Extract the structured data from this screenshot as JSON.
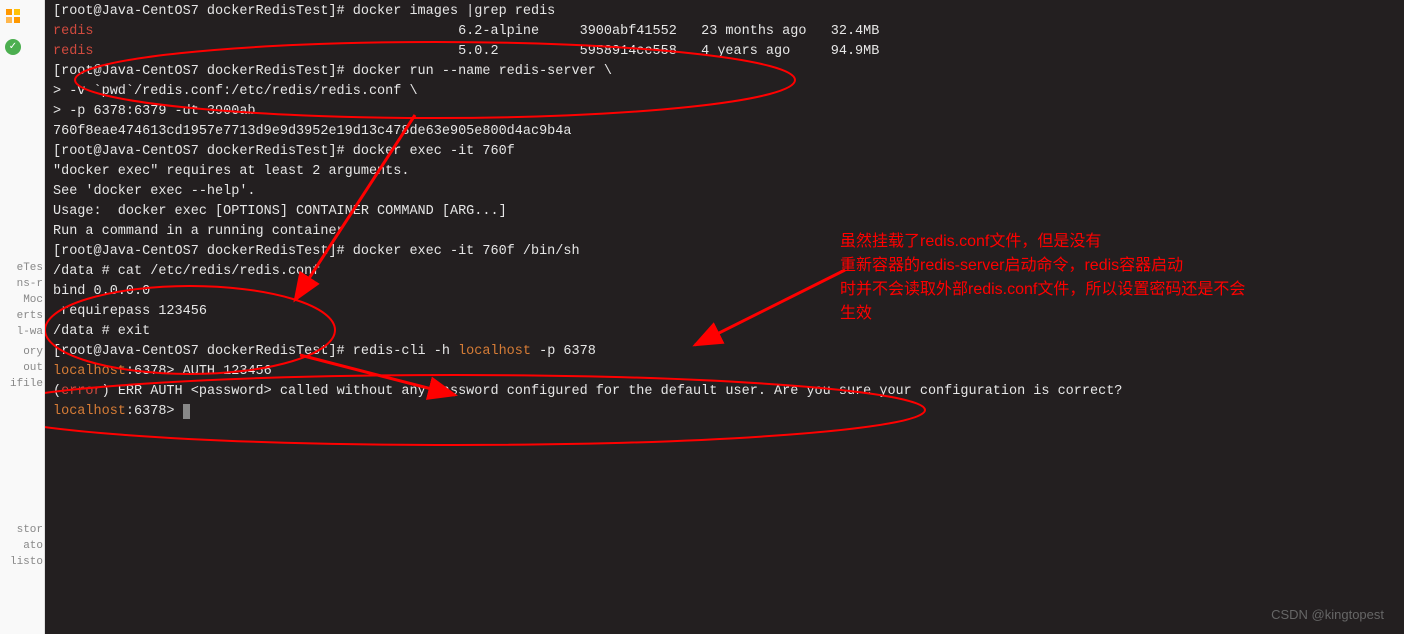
{
  "sidebar": {
    "top_icons": [
      {
        "color1": "#ff9800",
        "color2": "#ffc107"
      }
    ],
    "labels": [
      "eTes",
      "ns-r",
      "Moc",
      "erts",
      "l-wa",
      "",
      "ory",
      "out",
      "ifile",
      "",
      "",
      "",
      "stor",
      "ato",
      "listo"
    ]
  },
  "terminal": {
    "lines": [
      {
        "parts": [
          {
            "cls": "white",
            "text": "[root@Java-CentOS7 dockerRedisTest]# docker images |grep redis"
          }
        ]
      },
      {
        "parts": [
          {
            "cls": "red",
            "text": "redis"
          },
          {
            "cls": "white",
            "text": "                                             6.2-alpine     3900abf41552   23 months ago   32.4MB"
          }
        ]
      },
      {
        "parts": [
          {
            "cls": "red",
            "text": "redis"
          },
          {
            "cls": "white",
            "text": "                                             5.0.2          5958914cc558   4 years ago     94.9MB"
          }
        ]
      },
      {
        "parts": [
          {
            "cls": "white",
            "text": "[root@Java-CentOS7 dockerRedisTest]# docker run --name redis-server \\"
          }
        ]
      },
      {
        "parts": [
          {
            "cls": "white",
            "text": "> -v `pwd`/redis.conf:/etc/redis/redis.conf \\"
          }
        ]
      },
      {
        "parts": [
          {
            "cls": "white",
            "text": "> -p 6378:6379 -dt 3900ab"
          }
        ]
      },
      {
        "parts": [
          {
            "cls": "white",
            "text": "760f8eae474613cd1957e7713d9e9d3952e19d13c478de63e905e800d4ac9b4a"
          }
        ]
      },
      {
        "parts": [
          {
            "cls": "white",
            "text": "[root@Java-CentOS7 dockerRedisTest]# docker exec -it 760f"
          }
        ]
      },
      {
        "parts": [
          {
            "cls": "white",
            "text": "\"docker exec\" requires at least 2 arguments."
          }
        ]
      },
      {
        "parts": [
          {
            "cls": "white",
            "text": "See 'docker exec --help'."
          }
        ]
      },
      {
        "parts": [
          {
            "cls": "white",
            "text": ""
          }
        ]
      },
      {
        "parts": [
          {
            "cls": "white",
            "text": "Usage:  docker exec [OPTIONS] CONTAINER COMMAND [ARG...]"
          }
        ]
      },
      {
        "parts": [
          {
            "cls": "white",
            "text": ""
          }
        ]
      },
      {
        "parts": [
          {
            "cls": "white",
            "text": "Run a command in a running container"
          }
        ]
      },
      {
        "parts": [
          {
            "cls": "white",
            "text": "[root@Java-CentOS7 dockerRedisTest]# docker exec -it 760f /bin/sh"
          }
        ]
      },
      {
        "parts": [
          {
            "cls": "white",
            "text": "/data # cat /etc/redis/redis.conf"
          }
        ]
      },
      {
        "parts": [
          {
            "cls": "white",
            "text": "bind 0.0.0.0"
          }
        ]
      },
      {
        "parts": [
          {
            "cls": "white",
            "text": " requirepass 123456"
          }
        ]
      },
      {
        "parts": [
          {
            "cls": "white",
            "text": "/data # exit"
          }
        ]
      },
      {
        "parts": [
          {
            "cls": "white",
            "text": "[root@Java-CentOS7 dockerRedisTest]# redis-cli -h "
          },
          {
            "cls": "orange",
            "text": "localhost"
          },
          {
            "cls": "white",
            "text": " -p 6378"
          }
        ]
      },
      {
        "parts": [
          {
            "cls": "orange",
            "text": "localhost"
          },
          {
            "cls": "white",
            "text": ":6378> AUTH 123456"
          }
        ]
      },
      {
        "parts": [
          {
            "cls": "white",
            "text": "("
          },
          {
            "cls": "red",
            "text": "error"
          },
          {
            "cls": "white",
            "text": ") ERR AUTH <password> called without any password configured for the default user. Are you sure your configuration is correct?"
          }
        ]
      },
      {
        "parts": [
          {
            "cls": "orange",
            "text": "localhost"
          },
          {
            "cls": "white",
            "text": ":6378> "
          }
        ],
        "cursor": true
      }
    ]
  },
  "annotation": {
    "line1": "虽然挂载了redis.conf文件，但是没有",
    "line2": "重新容器的redis-server启动命令，redis容器启动",
    "line3": "时并不会读取外部redis.conf文件，所以设置密码还是不会",
    "line4": "生效"
  },
  "watermark": "CSDN @kingtopest"
}
